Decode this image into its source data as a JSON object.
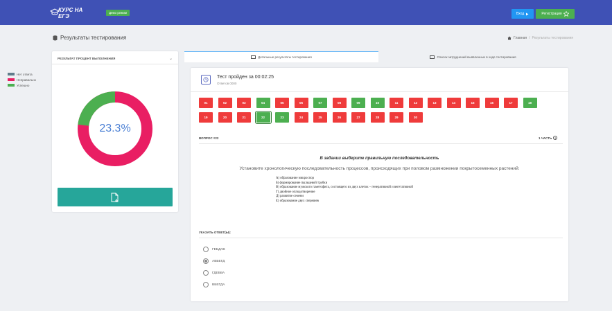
{
  "header": {
    "logo_text": "КУРС НА ЕГЭ",
    "demo_badge": "Демо режим",
    "login_label": "Вход",
    "register_label": "Регистрация",
    "bg_color": "#3f51b5"
  },
  "page": {
    "title": "Результаты тестирования",
    "breadcrumb": {
      "home": "Главная",
      "separator": "/",
      "current": "Результаты тестирования"
    }
  },
  "summary": {
    "header": "РЕЗУЛЬТАТ ПРОЦЕНТ ВЫПОЛНЕНИЯ",
    "legend": [
      {
        "label": "Нет ответа",
        "color": "#607d8b"
      },
      {
        "label": "Неправильно",
        "color": "#e91e63"
      },
      {
        "label": "Успешно",
        "color": "#4caf50"
      }
    ],
    "percent_label": "23.3%",
    "success_fraction": 0.233,
    "download_icon": "file-download-icon"
  },
  "tabs": [
    {
      "label": "Детальные результаты тестирования",
      "active": true
    },
    {
      "label": "Список затруднений выявленных в ходе тестирования",
      "active": false
    }
  ],
  "result": {
    "title": "Тест пройден за 00:02:25",
    "subtitle": "Ответов 0000"
  },
  "questions": [
    {
      "num": "01",
      "status": "red"
    },
    {
      "num": "02",
      "status": "red"
    },
    {
      "num": "03",
      "status": "red"
    },
    {
      "num": "04",
      "status": "green"
    },
    {
      "num": "05",
      "status": "red"
    },
    {
      "num": "06",
      "status": "red"
    },
    {
      "num": "07",
      "status": "green"
    },
    {
      "num": "08",
      "status": "red"
    },
    {
      "num": "09",
      "status": "green"
    },
    {
      "num": "10",
      "status": "green"
    },
    {
      "num": "11",
      "status": "red"
    },
    {
      "num": "12",
      "status": "red"
    },
    {
      "num": "13",
      "status": "red"
    },
    {
      "num": "14",
      "status": "red"
    },
    {
      "num": "15",
      "status": "red"
    },
    {
      "num": "16",
      "status": "red"
    },
    {
      "num": "17",
      "status": "red"
    },
    {
      "num": "18",
      "status": "green"
    },
    {
      "num": "19",
      "status": "red"
    },
    {
      "num": "20",
      "status": "red"
    },
    {
      "num": "21",
      "status": "red"
    },
    {
      "num": "22",
      "status": "green",
      "current": true
    },
    {
      "num": "23",
      "status": "green"
    },
    {
      "num": "24",
      "status": "red"
    },
    {
      "num": "25",
      "status": "red"
    },
    {
      "num": "26",
      "status": "red"
    },
    {
      "num": "27",
      "status": "red"
    },
    {
      "num": "28",
      "status": "red"
    },
    {
      "num": "29",
      "status": "red"
    },
    {
      "num": "30",
      "status": "red"
    }
  ],
  "question": {
    "label": "ВОПРОС #22",
    "part": "1 ЧАСТЬ",
    "help_glyph": "?",
    "heading": "В задании выберите правильную последовательность",
    "text": "Установите хронологическую последовательность процессов, происходящих при половом размножении покрытосеменных растений:",
    "options": [
      "А)  образование микроспор",
      "Б)  формирование пыльцевой трубки",
      "В) образование мужского гаметофита, состоящего из двух клеток – генеративной и вегетативной",
      "Г)  двойное оплодотворение",
      "Д)  развитие семени",
      "Е)  образование двух спермиев"
    ]
  },
  "answers": {
    "label": "УКАЗАТЬ ОТВЕТ(Ы):",
    "items": [
      {
        "label": "ГЕБДАВ",
        "selected": false
      },
      {
        "label": "АВБЕГД",
        "selected": true
      },
      {
        "label": "ГДЕБВА",
        "selected": false
      },
      {
        "label": "ВБЕГДА",
        "selected": false
      }
    ]
  }
}
